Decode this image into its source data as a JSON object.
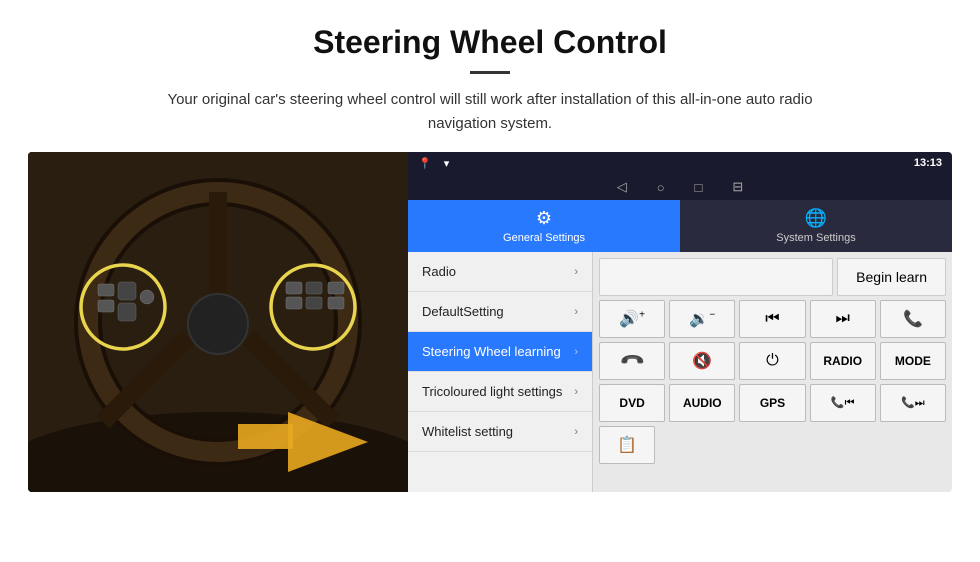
{
  "header": {
    "title": "Steering Wheel Control",
    "subtitle": "Your original car's steering wheel control will still work after installation of this all-in-one auto radio navigation system."
  },
  "android": {
    "status_bar": {
      "time": "13:13",
      "nav_icons": [
        "◁",
        "○",
        "□",
        "⊟"
      ]
    },
    "tabs": [
      {
        "id": "general",
        "label": "General Settings",
        "icon": "⚙",
        "active": true
      },
      {
        "id": "system",
        "label": "System Settings",
        "icon": "🌐",
        "active": false
      }
    ],
    "menu_items": [
      {
        "id": "radio",
        "label": "Radio",
        "active": false
      },
      {
        "id": "default",
        "label": "DefaultSetting",
        "active": false
      },
      {
        "id": "steering",
        "label": "Steering Wheel learning",
        "active": true
      },
      {
        "id": "tricoloured",
        "label": "Tricoloured light settings",
        "active": false
      },
      {
        "id": "whitelist",
        "label": "Whitelist setting",
        "active": false
      }
    ],
    "begin_learn_button": "Begin learn",
    "control_buttons": {
      "row1": [
        {
          "id": "vol-up",
          "label": "🔊+",
          "type": "icon"
        },
        {
          "id": "vol-down",
          "label": "🔉−",
          "type": "icon"
        },
        {
          "id": "prev-track",
          "label": "⏮",
          "type": "icon"
        },
        {
          "id": "next-track",
          "label": "⏭",
          "type": "icon"
        },
        {
          "id": "phone",
          "label": "📞",
          "type": "icon"
        }
      ],
      "row2": [
        {
          "id": "hang-up",
          "label": "📵",
          "type": "icon"
        },
        {
          "id": "mute",
          "label": "🔇×",
          "type": "icon"
        },
        {
          "id": "power",
          "label": "⏻",
          "type": "icon"
        },
        {
          "id": "radio-btn",
          "label": "RADIO",
          "type": "text"
        },
        {
          "id": "mode",
          "label": "MODE",
          "type": "text"
        }
      ],
      "row3": [
        {
          "id": "dvd",
          "label": "DVD",
          "type": "text"
        },
        {
          "id": "audio",
          "label": "AUDIO",
          "type": "text"
        },
        {
          "id": "gps",
          "label": "GPS",
          "type": "text"
        },
        {
          "id": "phone-prev",
          "label": "📞⏮",
          "type": "icon"
        },
        {
          "id": "phone-next",
          "label": "📞⏭",
          "type": "icon"
        }
      ],
      "row4": [
        {
          "id": "list-icon",
          "label": "≡📋",
          "type": "icon"
        }
      ]
    }
  }
}
